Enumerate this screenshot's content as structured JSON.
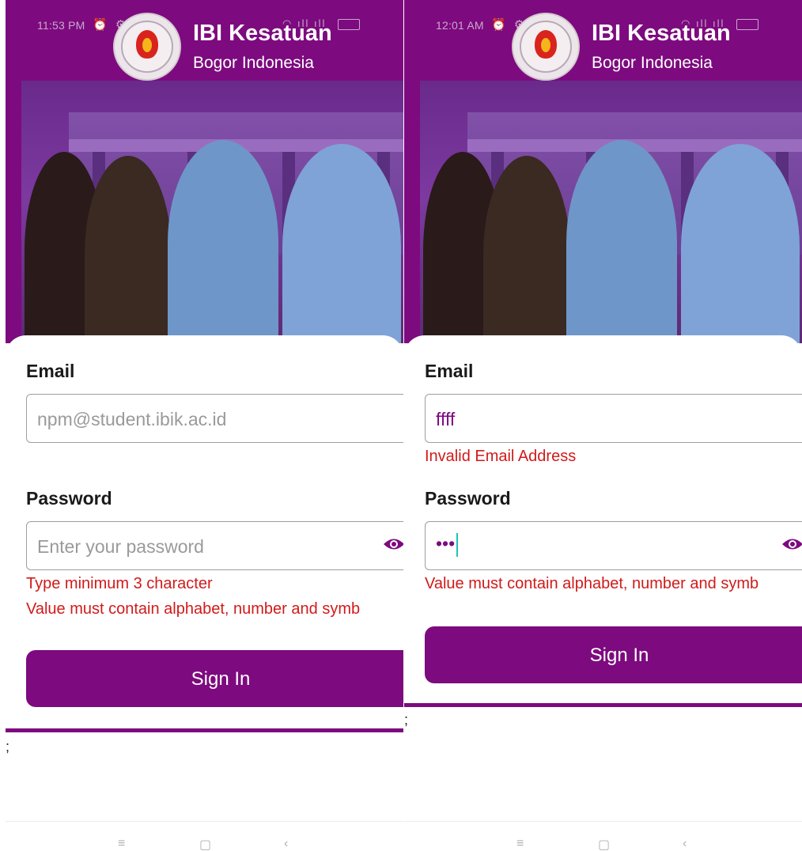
{
  "screens": [
    {
      "status_time": "11:53 PM",
      "brand_title": "IBI Kesatuan",
      "brand_sub": "Bogor Indonesia",
      "email_label": "Email",
      "email_placeholder": "npm@student.ibik.ac.id",
      "email_value": "",
      "email_error": "",
      "password_label": "Password",
      "password_placeholder": "Enter your password",
      "password_value": "",
      "password_errors": [
        "Type minimum 3 character",
        "Value must contain alphabet, number and symb"
      ],
      "sign_in_label": "Sign In",
      "semicolon": ";"
    },
    {
      "status_time": "12:01 AM",
      "brand_title": "IBI Kesatuan",
      "brand_sub": "Bogor Indonesia",
      "email_label": "Email",
      "email_placeholder": "",
      "email_value": "ffff",
      "email_error": "Invalid Email Address",
      "password_label": "Password",
      "password_placeholder": "",
      "password_value": "•••",
      "password_errors": [
        "Value must contain alphabet, number and symb"
      ],
      "sign_in_label": "Sign In",
      "semicolon": ";"
    }
  ],
  "nav": {
    "menu": "≡",
    "home": "▢",
    "back": "‹"
  },
  "colors": {
    "brand": "#7d0a7f",
    "error": "#d11a1a",
    "cursor": "#1fc3b8"
  },
  "icons": [
    "wifi-icon",
    "signal-icon",
    "battery-icon",
    "alarm-icon",
    "eye-icon",
    "logo-icon"
  ]
}
